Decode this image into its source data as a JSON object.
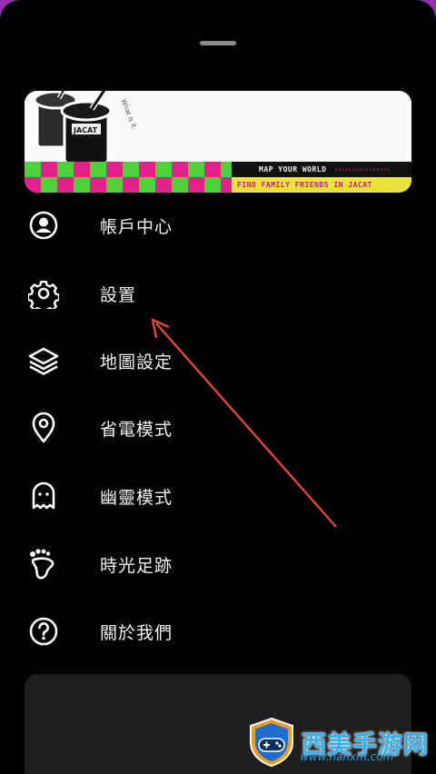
{
  "banner": {
    "cup_text": "JACAT",
    "side_text": "What is it",
    "strip_title": "MAP YOUR WORLD",
    "strip_subtitle": "FIND FAMILY FRIENDS IN JACAT"
  },
  "menu": {
    "items": [
      {
        "label": "帳戶中心",
        "icon": "account-icon"
      },
      {
        "label": "設置",
        "icon": "gear-icon"
      },
      {
        "label": "地圖設定",
        "icon": "layers-icon"
      },
      {
        "label": "省電模式",
        "icon": "location-pin-icon"
      },
      {
        "label": "幽靈模式",
        "icon": "ghost-icon"
      },
      {
        "label": "時光足跡",
        "icon": "footprint-icon"
      },
      {
        "label": "關於我們",
        "icon": "help-icon"
      }
    ]
  },
  "watermark": {
    "title": "西美手游网",
    "url": "www.hanxm.com"
  },
  "colors": {
    "background": "#000000",
    "text": "#f2f2f2",
    "accent_pink": "#e2218b",
    "accent_green": "#4fd13a",
    "accent_yellow": "#e8e23a",
    "annotation_arrow": "#e0483a"
  }
}
